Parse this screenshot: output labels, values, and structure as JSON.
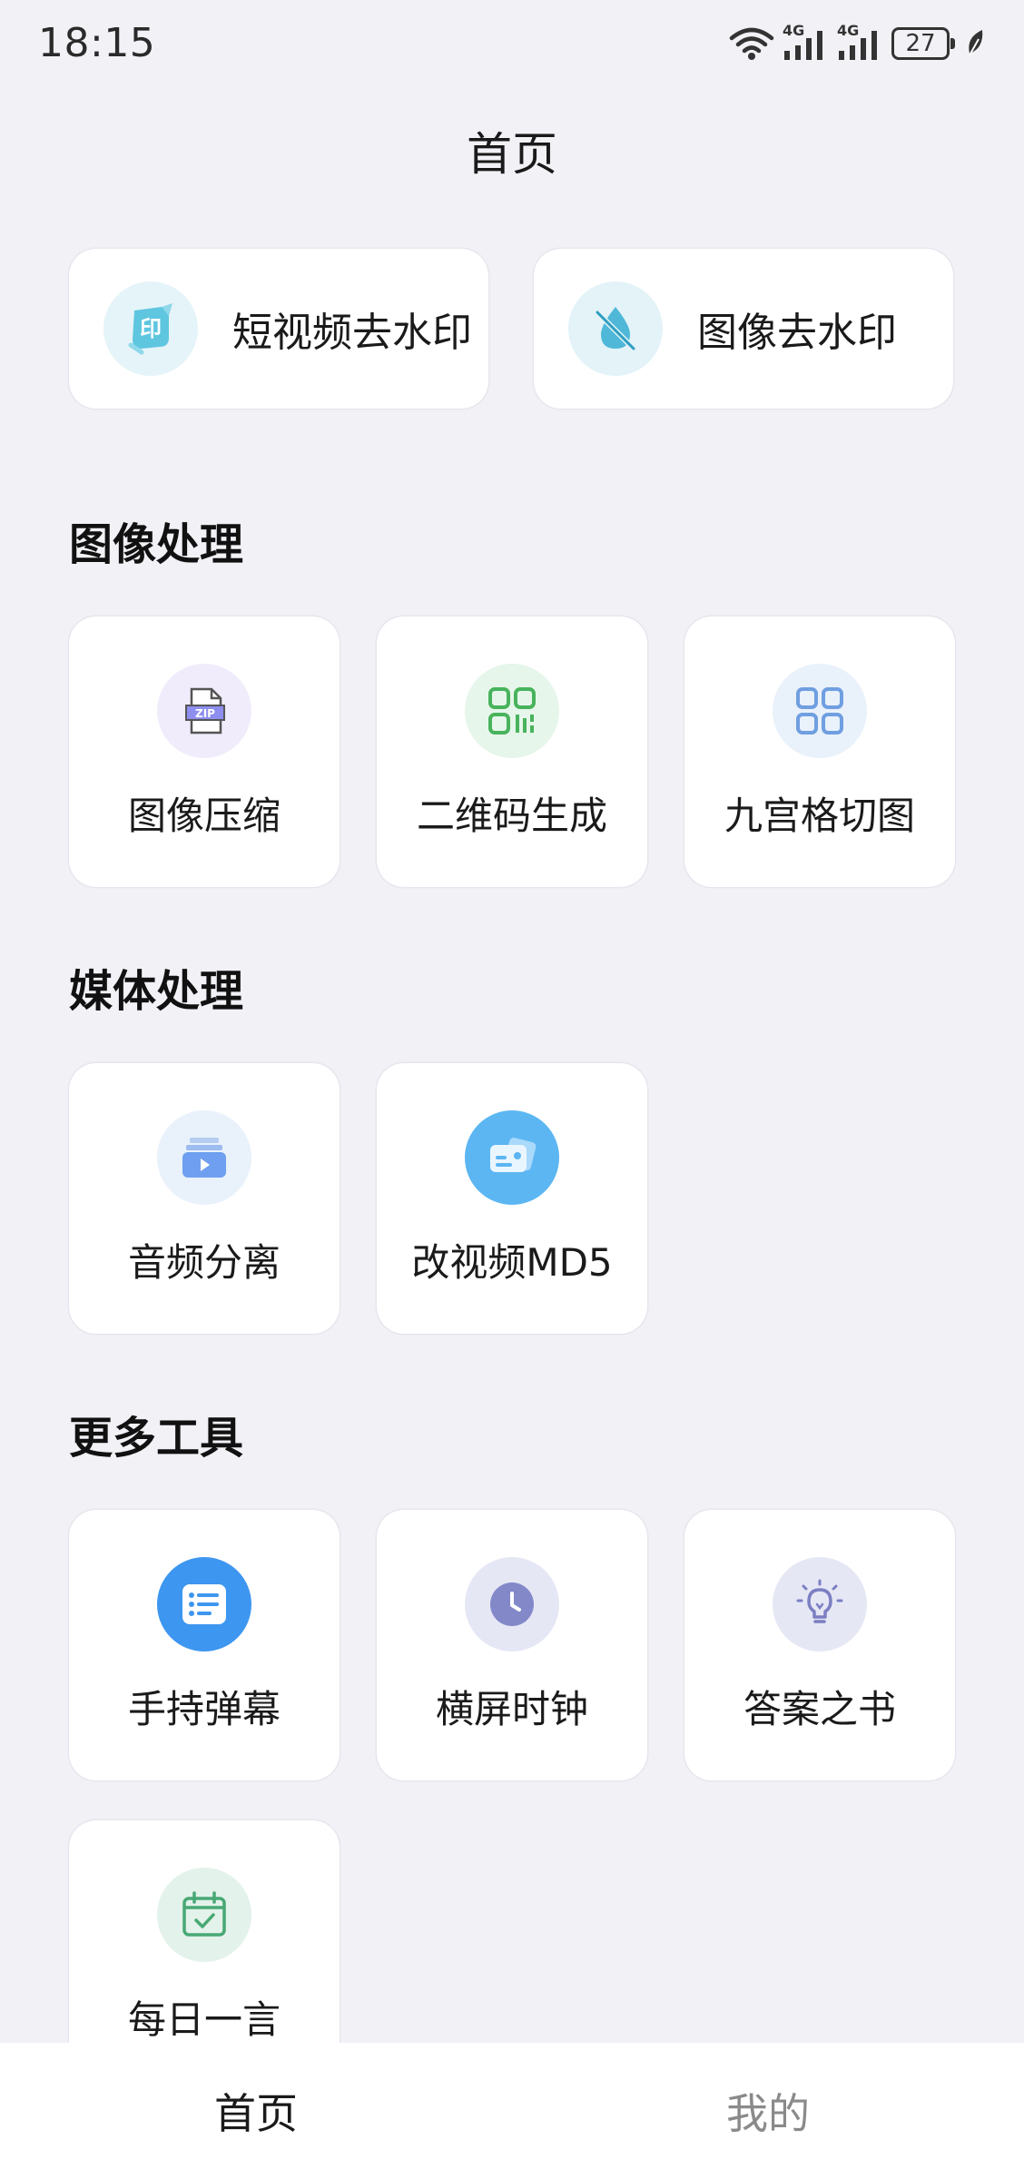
{
  "status_bar": {
    "time": "18:15",
    "battery": "27",
    "network_1": "4G",
    "network_2": "4G"
  },
  "page_title": "首页",
  "features": [
    {
      "label": "短视频去水印",
      "icon": "video-watermark-icon",
      "bg": "#e5f4f8",
      "color": "#3fb6d6"
    },
    {
      "label": "图像去水印",
      "icon": "image-watermark-icon",
      "bg": "#e3f3f8",
      "color": "#3fb6d6"
    }
  ],
  "sections": [
    {
      "title": "图像处理",
      "tools": [
        {
          "label": "图像压缩",
          "icon": "zip-file-icon",
          "bg": "#f1ecfb"
        },
        {
          "label": "二维码生成",
          "icon": "qr-code-icon",
          "bg": "#e6f6ea"
        },
        {
          "label": "九宫格切图",
          "icon": "grid-icon",
          "bg": "#e9f1fb"
        }
      ]
    },
    {
      "title": "媒体处理",
      "tools": [
        {
          "label": "音频分离",
          "icon": "audio-separate-icon",
          "bg": "#e9f1fb"
        },
        {
          "label": "改视频MD5",
          "icon": "video-md5-icon",
          "bg": "#5cb6f2"
        }
      ]
    },
    {
      "title": "更多工具",
      "tools": [
        {
          "label": "手持弹幕",
          "icon": "danmaku-icon",
          "bg": "#3d96f0"
        },
        {
          "label": "横屏时钟",
          "icon": "clock-icon",
          "bg": "#e6e7f5"
        },
        {
          "label": "答案之书",
          "icon": "lightbulb-icon",
          "bg": "#e6e7f5"
        },
        {
          "label": "每日一言",
          "icon": "calendar-check-icon",
          "bg": "#e3f2ea"
        }
      ]
    }
  ],
  "bottom_nav": {
    "home": "首页",
    "mine": "我的"
  }
}
